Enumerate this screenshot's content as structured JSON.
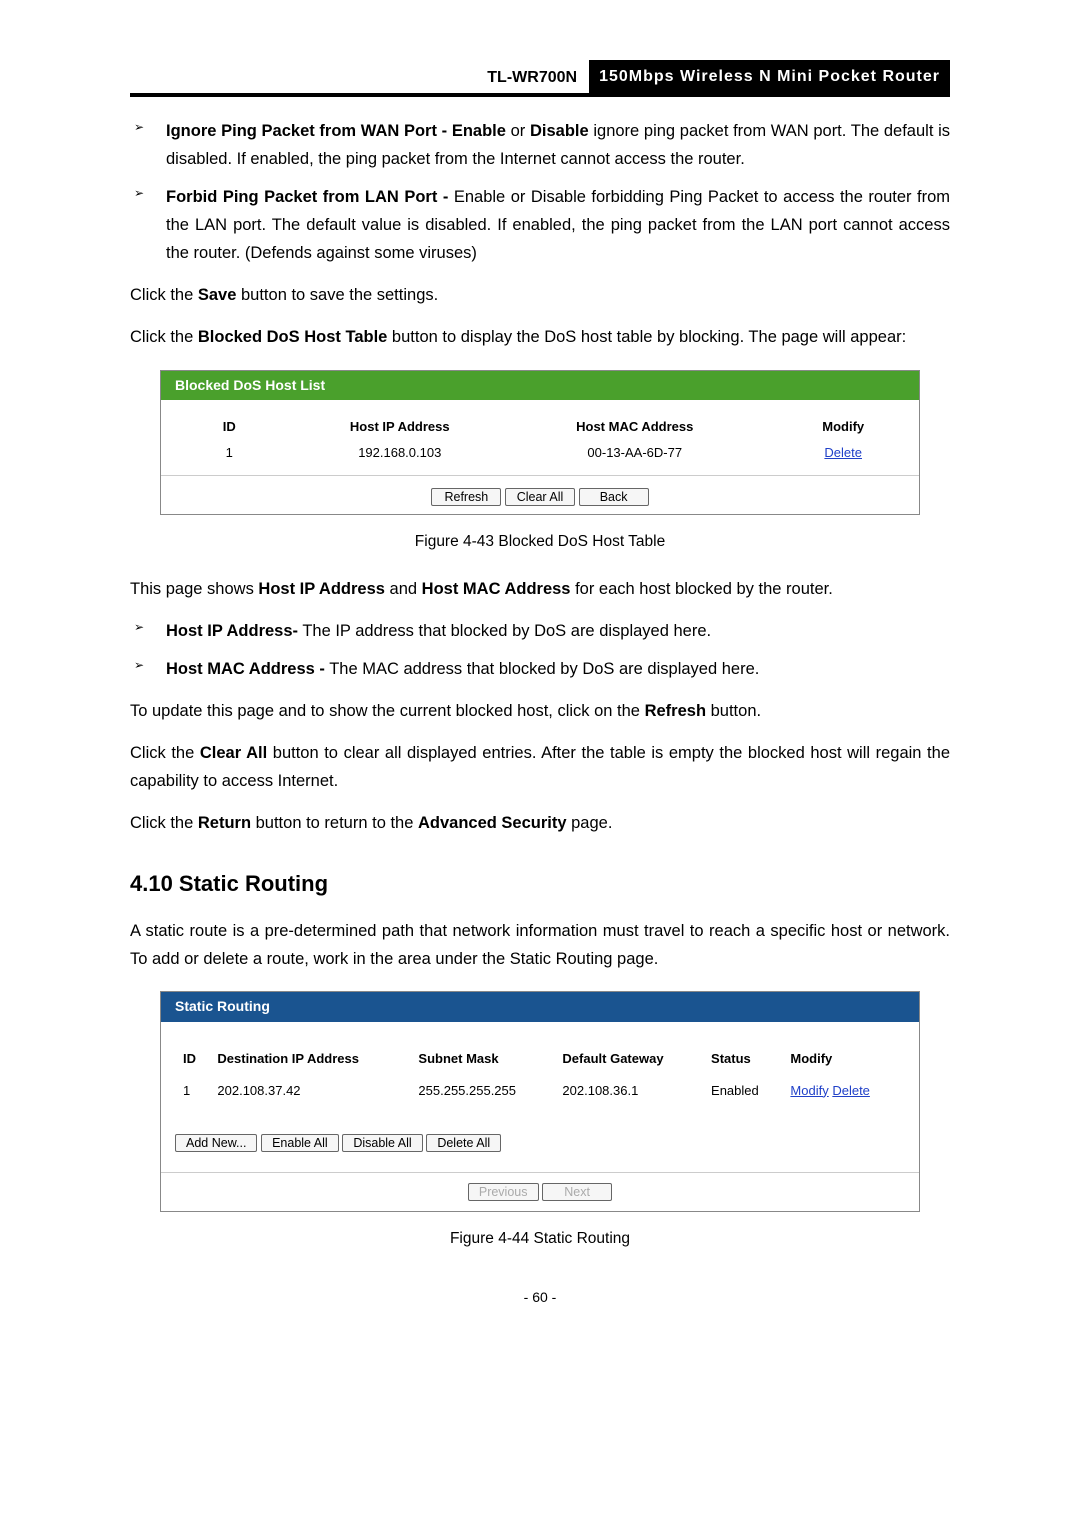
{
  "header": {
    "model": "TL-WR700N",
    "desc": "150Mbps Wireless N Mini Pocket Router"
  },
  "bullets1": {
    "a_pre": "Ignore Ping Packet from WAN Port - Enable",
    "a_or": " or ",
    "a_dis": "Disable",
    "a_post": " ignore ping packet from WAN port. The default is disabled. If enabled, the ping packet from the Internet cannot access the router.",
    "b_pre": "Forbid Ping Packet from LAN Port -",
    "b_post": " Enable or Disable forbidding Ping Packet to access the router from the LAN port. The default value is disabled. If enabled, the ping packet from the LAN port cannot access the router. (Defends against some viruses)"
  },
  "p1": {
    "pre": "Click the ",
    "mid": "Save",
    "post": " button to save the settings."
  },
  "p2": {
    "pre": "Click the ",
    "mid": "Blocked DoS Host Table",
    "post": " button to display the DoS host table by blocking. The page will appear:"
  },
  "dosbox": {
    "title": "Blocked DoS Host List",
    "cols": {
      "id": "ID",
      "ip": "Host IP Address",
      "mac": "Host MAC Address",
      "mod": "Modify"
    },
    "row": {
      "id": "1",
      "ip": "192.168.0.103",
      "mac": "00-13-AA-6D-77",
      "del": "Delete"
    },
    "btn_refresh": "Refresh",
    "btn_clearall": "Clear All",
    "btn_back": "Back"
  },
  "figcap1": "Figure 4-43 Blocked DoS Host Table",
  "p3": {
    "pre": "This page shows ",
    "a": "Host IP Address",
    "mid": " and ",
    "b": "Host MAC Address",
    "post": " for each host blocked by the router."
  },
  "bullets2": {
    "a_pre": "Host IP Address-",
    "a_post": " The IP address that blocked by DoS are displayed here.",
    "b_pre": "Host MAC Address -",
    "b_post": " The MAC address that blocked by DoS are displayed here."
  },
  "p4": {
    "pre": "To update this page and to show the current blocked host, click on the ",
    "mid": "Refresh",
    "post": " button."
  },
  "p5": {
    "pre": "Click the ",
    "mid": "Clear All",
    "post": " button to clear all displayed entries. After the table is empty the blocked host will regain the capability to access Internet."
  },
  "p6": {
    "pre": "Click the ",
    "a": "Return",
    "mid": " button to return to the ",
    "b": "Advanced Security",
    "post": " page."
  },
  "section": "4.10  Static Routing",
  "p7": "A static route is a pre-determined path that network information must travel to reach a specific host or network. To add or delete a route, work in the area under the Static Routing page.",
  "routebox": {
    "title": "Static Routing",
    "cols": {
      "id": "ID",
      "dest": "Destination IP Address",
      "mask": "Subnet Mask",
      "gw": "Default Gateway",
      "status": "Status",
      "mod": "Modify"
    },
    "row": {
      "id": "1",
      "dest": "202.108.37.42",
      "mask": "255.255.255.255",
      "gw": "202.108.36.1",
      "status": "Enabled",
      "mod": "Modify",
      "del": "Delete"
    },
    "btn_add": "Add New...",
    "btn_en": "Enable All",
    "btn_dis": "Disable All",
    "btn_del": "Delete All",
    "btn_prev": "Previous",
    "btn_next": "Next"
  },
  "figcap2": "Figure 4-44 Static Routing",
  "pagenum": "- 60 -"
}
